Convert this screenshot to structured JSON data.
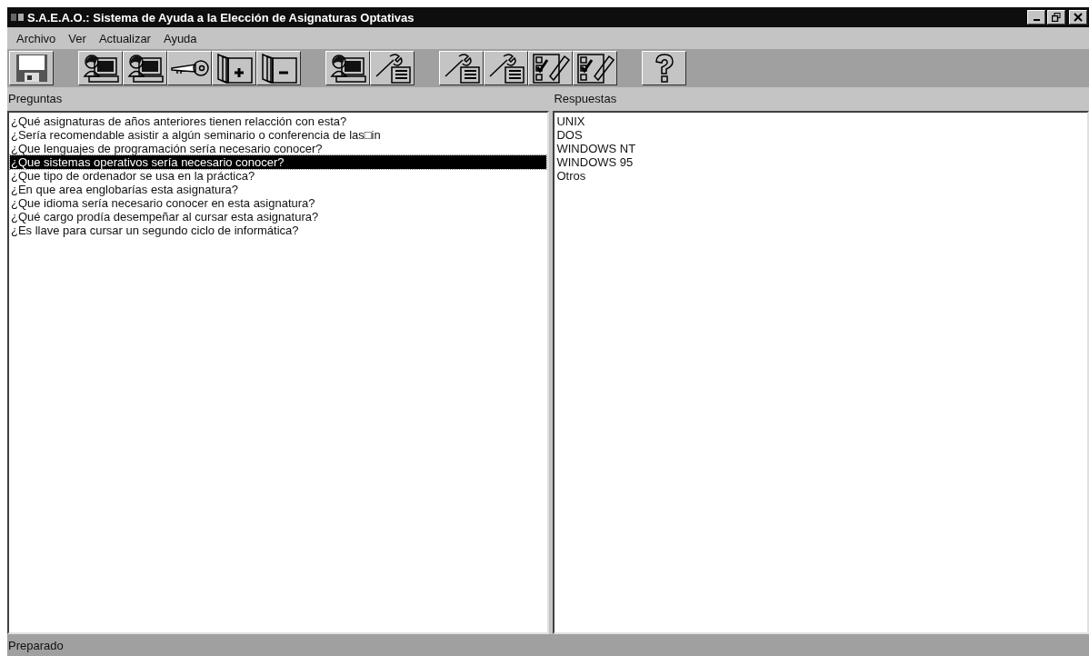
{
  "window": {
    "title": "S.A.E.A.O.: Sistema de Ayuda a la Elección de Asignaturas Optativas"
  },
  "menu": [
    "Archivo",
    "Ver",
    "Actualizar",
    "Ayuda"
  ],
  "toolbar_groups": [
    [
      {
        "kind": "save"
      }
    ],
    [
      {
        "kind": "person"
      },
      {
        "kind": "person"
      },
      {
        "kind": "key"
      },
      {
        "kind": "book-plus"
      },
      {
        "kind": "book-minus"
      }
    ],
    [
      {
        "kind": "person"
      },
      {
        "kind": "wrench"
      }
    ],
    [
      {
        "kind": "wrench"
      },
      {
        "kind": "wrench"
      },
      {
        "kind": "checklist"
      },
      {
        "kind": "checklist"
      }
    ],
    [
      {
        "kind": "help"
      }
    ]
  ],
  "questions": {
    "label": "Preguntas",
    "items": [
      {
        "text": "¿Qué asignaturas de años anteriores tienen relacción con esta?",
        "selected": false
      },
      {
        "text": "¿Sería recomendable asistir a algún seminario o conferencia de las□in",
        "selected": false
      },
      {
        "text": "¿Que lenguajes de programación sería necesario conocer?",
        "selected": false
      },
      {
        "text": "¿Que sistemas operativos sería necesario conocer?",
        "selected": true
      },
      {
        "text": "¿Que tipo de ordenador se usa en la práctica?",
        "selected": false
      },
      {
        "text": "¿En que area englobarías esta asignatura?",
        "selected": false
      },
      {
        "text": "¿Que idioma sería necesario conocer en esta asignatura?",
        "selected": false
      },
      {
        "text": "¿Qué cargo prodía desempeñar al cursar esta asignatura?",
        "selected": false
      },
      {
        "text": "¿Es llave para cursar un segundo ciclo de informática?",
        "selected": false
      }
    ]
  },
  "answers": {
    "label": "Respuestas",
    "items": [
      {
        "text": "UNIX",
        "selected": false
      },
      {
        "text": "DOS",
        "selected": false
      },
      {
        "text": "WINDOWS NT",
        "selected": false
      },
      {
        "text": "WINDOWS 95",
        "selected": false
      },
      {
        "text": "Otros",
        "selected": false
      }
    ]
  },
  "status_bar": "Preparado"
}
